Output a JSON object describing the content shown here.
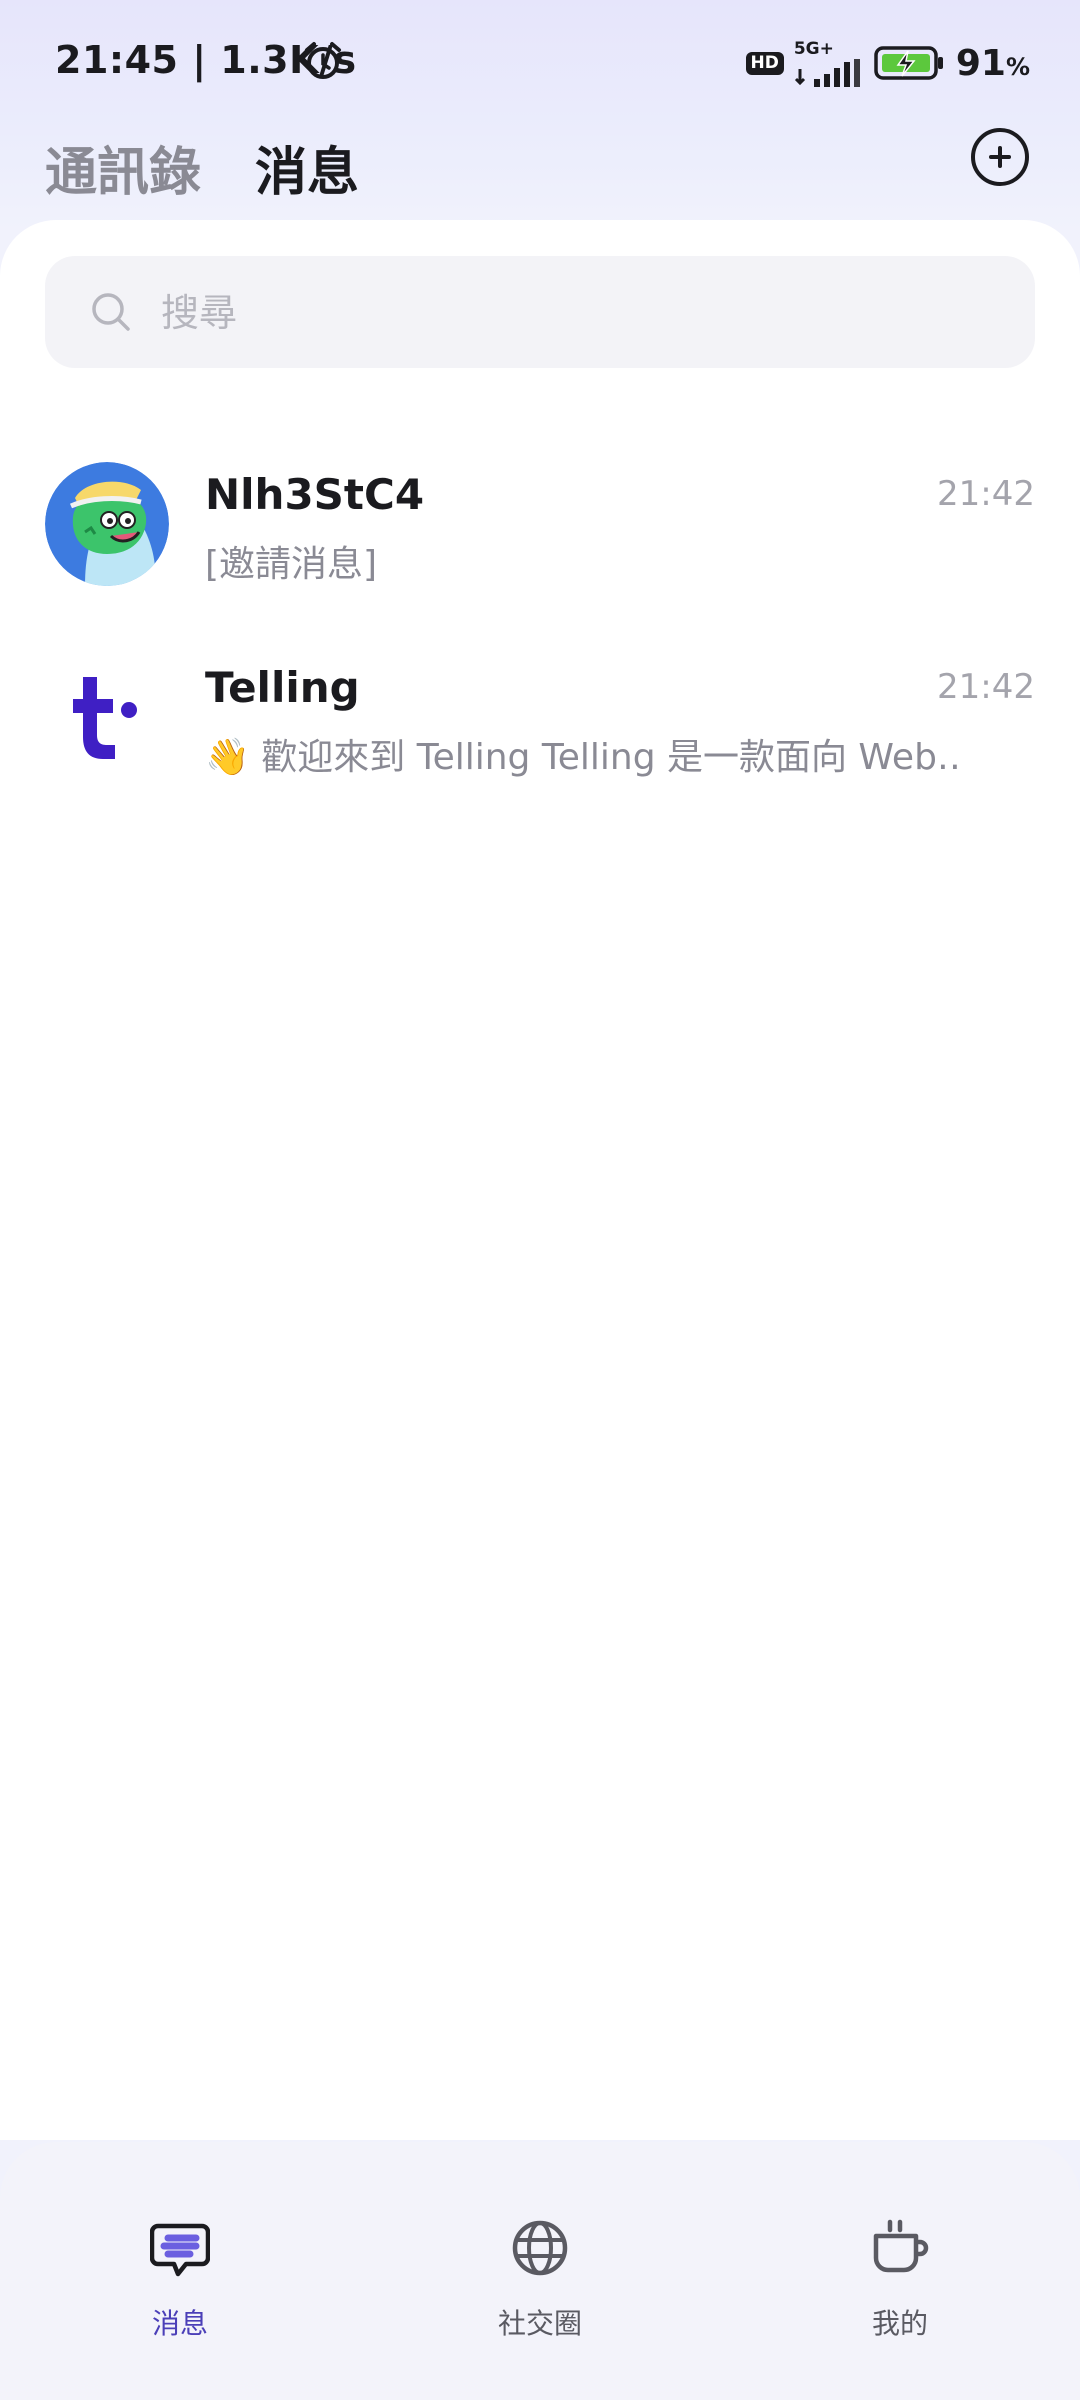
{
  "status_bar": {
    "time": "21:45 | 1.3K/s",
    "hd": "HD",
    "network": "5G+",
    "battery_percent": "91",
    "percent_sign": "%"
  },
  "header": {
    "tabs": [
      {
        "label": "通訊錄"
      },
      {
        "label": "消息"
      }
    ],
    "active_tab": "消息"
  },
  "search": {
    "placeholder": "搜尋",
    "value": ""
  },
  "chats": [
    {
      "name": "Nlh3StC4",
      "time": "21:42",
      "preview": "[邀請消息]"
    },
    {
      "name": "Telling",
      "time": "21:42",
      "preview": "👋 歡迎來到 Telling Telling 是一款面向 Web‥"
    }
  ],
  "bottom_nav": {
    "items": [
      {
        "label": "消息",
        "icon": "chat-bubble-icon"
      },
      {
        "label": "社交圈",
        "icon": "globe-icon"
      },
      {
        "label": "我的",
        "icon": "coffee-cup-icon"
      }
    ],
    "active": "消息"
  },
  "colors": {
    "accent": "#4b3fb8",
    "telling_brand": "#3f1fc4",
    "inactive": "#5a5a62"
  }
}
